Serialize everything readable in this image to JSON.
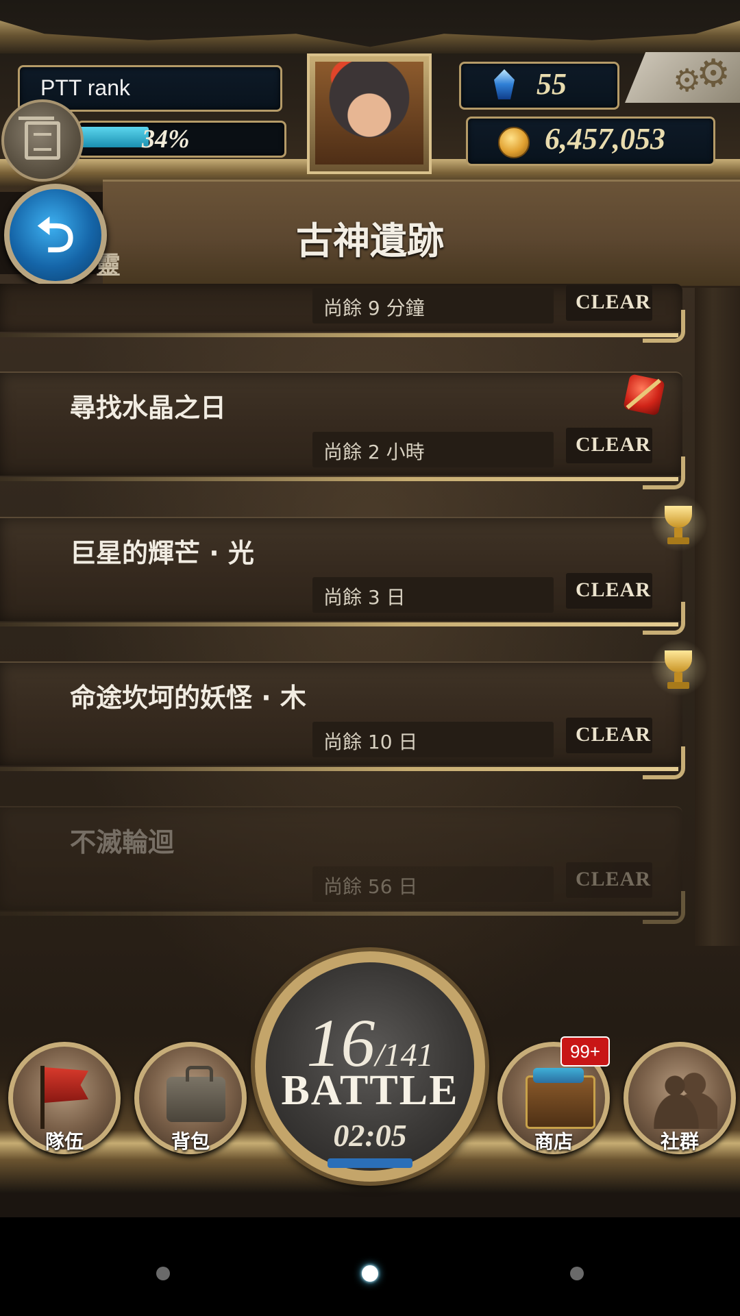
{
  "header": {
    "rank_label": "PTT rank",
    "exp_percent": 34,
    "exp_text": "34%",
    "gems": "55",
    "gold": "6,457,053"
  },
  "title_bar": {
    "title": "古神遺跡",
    "back_icon": "back-arrow-icon",
    "partial_label": "靈"
  },
  "quests": [
    {
      "name": "",
      "time_left": "尚餘 9 分鐘",
      "clear_label": "CLEAR",
      "badge": ""
    },
    {
      "name": "尋找水晶之日",
      "time_left": "尚餘 2 小時",
      "clear_label": "CLEAR",
      "badge": "red-gem-icon"
    },
    {
      "name": "巨星的輝芒 · 光",
      "time_left": "尚餘 3 日",
      "clear_label": "CLEAR",
      "badge": "trophy-icon"
    },
    {
      "name": "命途坎坷的妖怪 · 木",
      "time_left": "尚餘 10 日",
      "clear_label": "CLEAR",
      "badge": "trophy-icon"
    },
    {
      "name": "不滅輪迴",
      "time_left": "尚餘 56 日",
      "clear_label": "CLEAR",
      "badge": "",
      "dimmed": true
    }
  ],
  "nav": {
    "team": "隊伍",
    "bag": "背包",
    "shop": "商店",
    "social": "社群",
    "shop_badge": "99+"
  },
  "battle": {
    "current": "16",
    "total": "/141",
    "label": "BATTLE",
    "timer": "02:05"
  },
  "colors": {
    "accent_gold": "#c8ae76",
    "exp_bar": "#3fbfe0",
    "badge_red": "#c81616"
  }
}
